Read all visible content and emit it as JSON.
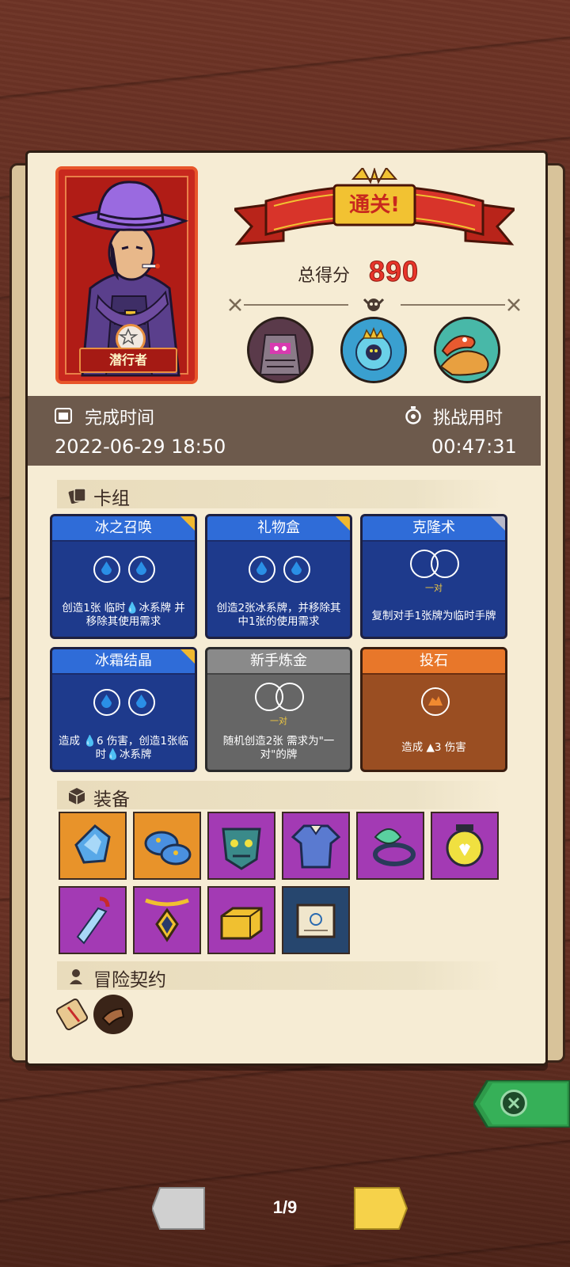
{
  "result": {
    "banner_text": "通关!",
    "total_label": "总得分",
    "total_score": "890"
  },
  "character": {
    "name": "潜行者"
  },
  "stats": {
    "finish_time_label": "完成时间",
    "finish_time_value": "2022-06-29 18:50",
    "duration_label": "挑战用时",
    "duration_value": "00:47:31"
  },
  "sections": {
    "deck": "卡组",
    "equipment": "装备",
    "contracts": "冒险契约"
  },
  "cards": [
    {
      "title": "冰之召唤",
      "desc": "创造1张 临时💧冰系牌 并移除其使用需求",
      "type": "blue"
    },
    {
      "title": "礼物盒",
      "desc": "创造2张冰系牌，并移除其中1张的使用需求",
      "type": "blue"
    },
    {
      "title": "克隆术",
      "desc": "复制对手1张牌为临时手牌",
      "type": "blue",
      "pair_label": "一对"
    },
    {
      "title": "冰霜结晶",
      "desc": "造成 💧6 伤害，创造1张临时💧冰系牌",
      "type": "blue"
    },
    {
      "title": "新手炼金",
      "desc": "随机创造2张 需求为\"一对\"的牌",
      "type": "grey",
      "pair_label": "一对"
    },
    {
      "title": "投石",
      "desc": "造成 ▲3 伤害",
      "type": "orange"
    }
  ],
  "equipment": [
    {
      "icon": "crystal-shard-icon",
      "rarity": "orange"
    },
    {
      "icon": "blue-mushroom-icon",
      "rarity": "orange"
    },
    {
      "icon": "demon-mask-icon",
      "rarity": "purple"
    },
    {
      "icon": "tunic-armor-icon",
      "rarity": "purple"
    },
    {
      "icon": "leaf-ring-icon",
      "rarity": "purple"
    },
    {
      "icon": "heart-lantern-icon",
      "rarity": "purple"
    },
    {
      "icon": "ice-dagger-icon",
      "rarity": "purple"
    },
    {
      "icon": "gem-amulet-icon",
      "rarity": "purple"
    },
    {
      "icon": "gold-bar-icon",
      "rarity": "purple"
    },
    {
      "icon": "map-scroll-icon",
      "rarity": "navy"
    }
  ],
  "pager": {
    "text": "1/9"
  },
  "colors": {
    "score": "#e8352a",
    "banner": "#c8281e",
    "blue_card": "#1e3a8c",
    "orange_card": "#9a4e22",
    "grey_card": "#666666"
  }
}
